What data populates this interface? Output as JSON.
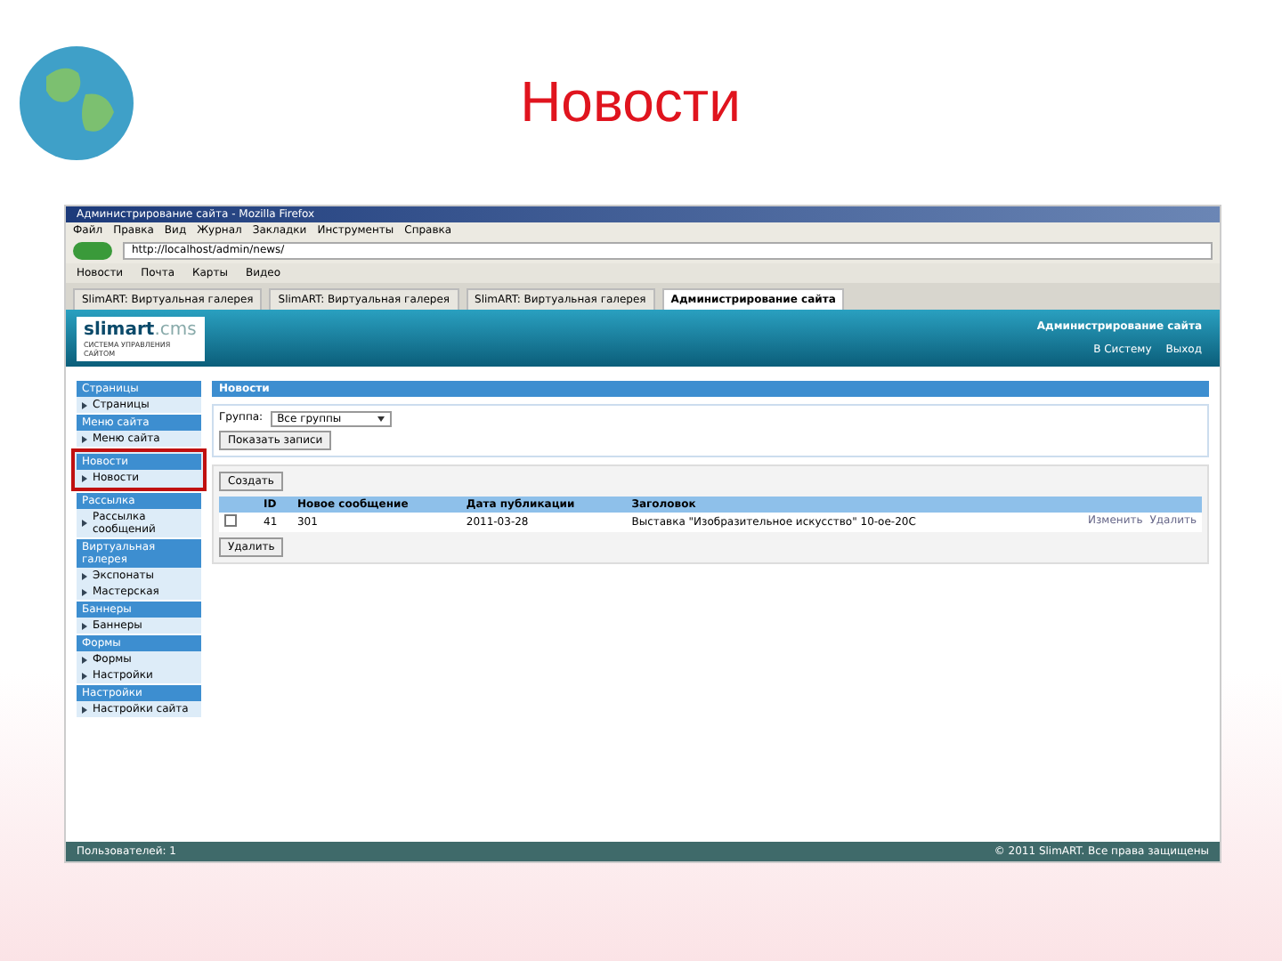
{
  "slide": {
    "title": "Новости"
  },
  "browser": {
    "window_title": "Администрирование сайта - Mozilla Firefox",
    "menu": [
      "Файл",
      "Правка",
      "Вид",
      "Журнал",
      "Закладки",
      "Инструменты",
      "Справка"
    ],
    "url": "http://localhost/admin/news/",
    "bookmarks": [
      "Новости",
      "Почта",
      "Карты",
      "Видео"
    ],
    "tabs": [
      {
        "label": "SlimART: Виртуальная галерея",
        "selected": false
      },
      {
        "label": "SlimART: Виртуальная галерея",
        "selected": false
      },
      {
        "label": "SlimART: Виртуальная галерея",
        "selected": false
      },
      {
        "label": "Администрирование сайта",
        "selected": true
      }
    ]
  },
  "site": {
    "logo": "slimart",
    "logo_suffix": ".cms",
    "tagline": "СИСТЕМА УПРАВЛЕНИЯ САЙТОМ",
    "notice": "Администрирование сайта",
    "links": [
      "В Систему",
      "Выход"
    ]
  },
  "sidebar": [
    {
      "title": "Страницы",
      "highlighted": false,
      "items": [
        "Страницы"
      ]
    },
    {
      "title": "Меню сайта",
      "highlighted": false,
      "items": [
        "Меню сайта"
      ]
    },
    {
      "title": "Новости",
      "highlighted": true,
      "items": [
        "Новости"
      ]
    },
    {
      "title": "Рассылка",
      "highlighted": false,
      "items": [
        "Рассылка сообщений"
      ]
    },
    {
      "title": "Виртуальная галерея",
      "highlighted": false,
      "items": [
        "Экспонаты",
        "Мастерская"
      ]
    },
    {
      "title": "Баннеры",
      "highlighted": false,
      "items": [
        "Баннеры"
      ]
    },
    {
      "title": "Формы",
      "highlighted": false,
      "items": [
        "Формы",
        "Настройки"
      ]
    },
    {
      "title": "Настройки",
      "highlighted": false,
      "items": [
        "Настройки сайта"
      ]
    }
  ],
  "panel": {
    "title": "Новости",
    "filter_label": "Группа:",
    "filter_value": "Все группы",
    "filter_button": "Показать записи",
    "create_button": "Создать",
    "delete_button": "Удалить",
    "columns": [
      "ID",
      "Новое сообщение",
      "Дата публикации",
      "Заголовок"
    ],
    "rows": [
      {
        "checked": false,
        "cells": [
          "41",
          "301",
          "2011-03-28",
          "Выставка \"Изобразительное искусство\" 10-ое-20С"
        ],
        "actions": [
          "Изменить",
          "Удалить"
        ]
      }
    ]
  },
  "status": {
    "left": "Пользователей: 1",
    "right": "© 2011 SlimART. Все права защищены"
  }
}
